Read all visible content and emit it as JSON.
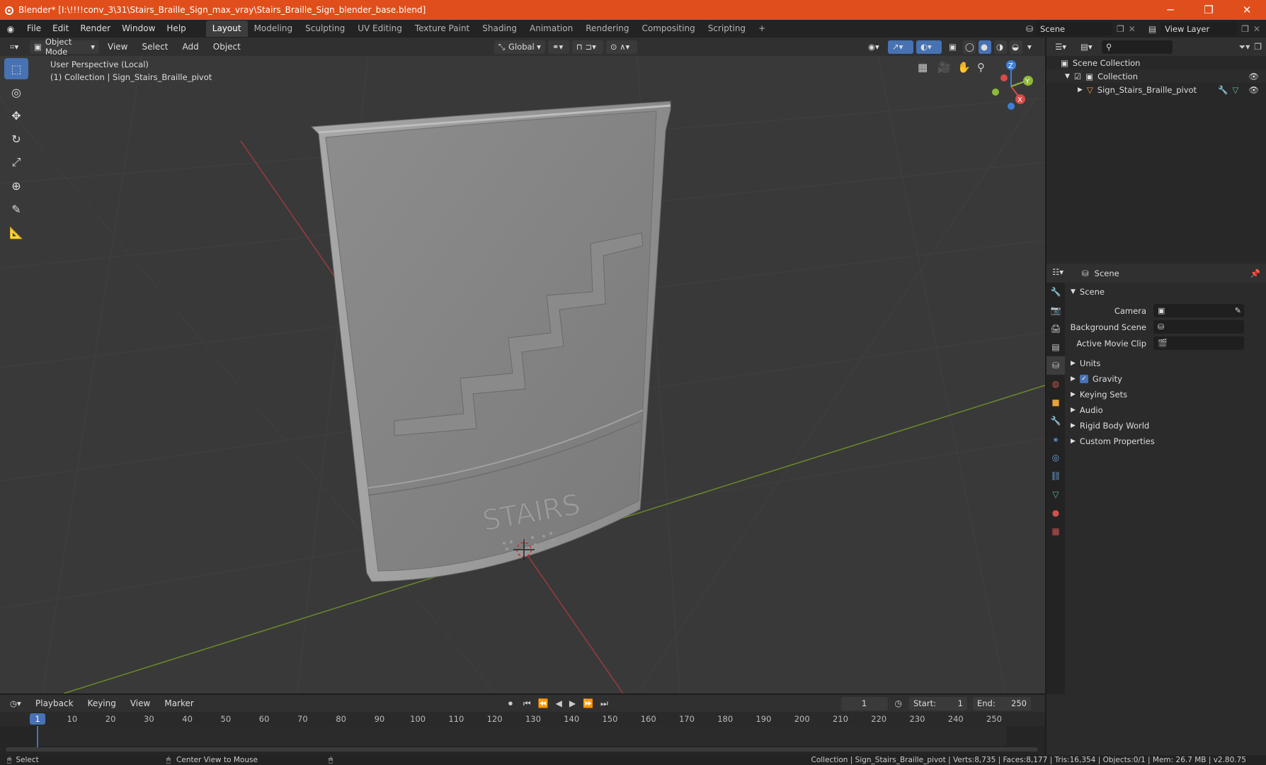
{
  "window": {
    "title": "Blender* [I:\\!!!!conv_3\\31\\Stairs_Braille_Sign_max_vray\\Stairs_Braille_Sign_blender_base.blend]",
    "minimize": "─",
    "restore": "❐",
    "close": "✕"
  },
  "menus": [
    "File",
    "Edit",
    "Render",
    "Window",
    "Help"
  ],
  "workspaces": [
    "Layout",
    "Modeling",
    "Sculpting",
    "UV Editing",
    "Texture Paint",
    "Shading",
    "Animation",
    "Rendering",
    "Compositing",
    "Scripting"
  ],
  "add_workspace": "+",
  "scene_selector": {
    "value": "Scene"
  },
  "view_layer": {
    "value": "View Layer"
  },
  "viewport_header": {
    "mode": "Object Mode",
    "menus": [
      "View",
      "Select",
      "Add",
      "Object"
    ],
    "orientation": "Global"
  },
  "viewport": {
    "perspective": "User Perspective (Local)",
    "collection_info": "(1) Collection | Sign_Stairs_Braille_pivot",
    "sign_text": "STAIRS"
  },
  "gizmo": {
    "z": "Z",
    "y": "Y",
    "x": "X"
  },
  "outliner": {
    "rows": [
      {
        "label": "Scene Collection"
      },
      {
        "label": "Collection"
      },
      {
        "label": "Sign_Stairs_Braille_pivot"
      }
    ]
  },
  "properties": {
    "header": "Scene",
    "section": "Scene",
    "fields": [
      {
        "label": "Camera",
        "value": ""
      },
      {
        "label": "Background Scene",
        "value": ""
      },
      {
        "label": "Active Movie Clip",
        "value": ""
      }
    ],
    "panels": [
      "Units",
      "Gravity",
      "Keying Sets",
      "Audio",
      "Rigid Body World",
      "Custom Properties"
    ],
    "gravity_checked": true
  },
  "timeline": {
    "menus": [
      "Playback",
      "Keying",
      "View",
      "Marker"
    ],
    "current_frame": "1",
    "start_label": "Start:",
    "start": "1",
    "end_label": "End:",
    "end": "250",
    "ruler": [
      "1",
      "10",
      "20",
      "30",
      "40",
      "50",
      "60",
      "70",
      "80",
      "90",
      "100",
      "110",
      "120",
      "130",
      "140",
      "150",
      "160",
      "170",
      "180",
      "190",
      "200",
      "210",
      "220",
      "230",
      "240",
      "250"
    ]
  },
  "statusbar": {
    "left": "Select",
    "middle": "Center View to Mouse",
    "right": "Collection | Sign_Stairs_Braille_pivot | Verts:8,735 | Faces:8,177 | Tris:16,354 | Objects:0/1 | Mem: 26.7 MB | v2.80.75"
  },
  "colors": {
    "accent": "#4772b3",
    "titlebar": "#e04e1b",
    "x_axis": "#d94a4a",
    "y_axis": "#8fb83a",
    "z_axis": "#3e7fd9"
  }
}
